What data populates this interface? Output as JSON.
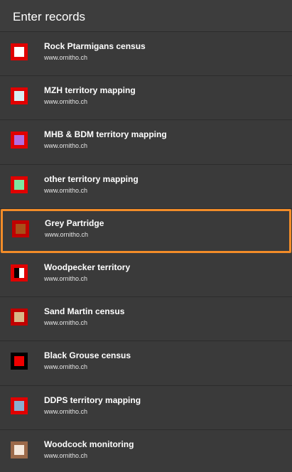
{
  "header": {
    "title": "Enter records"
  },
  "selected_index": 4,
  "items": [
    {
      "title": "Rock Ptarmigans census",
      "subtitle": "www.ornitho.ch",
      "icon": "square-white-on-red",
      "outer": "#e00000",
      "inner": "#ffffff"
    },
    {
      "title": "MZH territory mapping",
      "subtitle": "www.ornitho.ch",
      "icon": "square-lightcyan-on-red",
      "outer": "#e00000",
      "inner": "#d8eef2"
    },
    {
      "title": "MHB & BDM territory mapping",
      "subtitle": "www.ornitho.ch",
      "icon": "square-violet-on-red",
      "outer": "#e00000",
      "inner": "#b46de0"
    },
    {
      "title": "other territory mapping",
      "subtitle": "www.ornitho.ch",
      "icon": "square-green-on-red",
      "outer": "#e00000",
      "inner": "#7ee6a0"
    },
    {
      "title": "Grey Partridge",
      "subtitle": "www.ornitho.ch",
      "icon": "square-brown-on-red",
      "outer": "#c00000",
      "inner": "#a8501a"
    },
    {
      "title": "Woodpecker territory",
      "subtitle": "www.ornitho.ch",
      "icon": "square-blackwhite-on-red",
      "outer": "#e00000",
      "inner": "split"
    },
    {
      "title": "Sand Martin census",
      "subtitle": "www.ornitho.ch",
      "icon": "square-tan-on-red",
      "outer": "#c00000",
      "inner": "#d8b888"
    },
    {
      "title": "Black Grouse census",
      "subtitle": "www.ornitho.ch",
      "icon": "square-red-on-black",
      "outer": "#000000",
      "inner": "#ee0000"
    },
    {
      "title": "DDPS territory mapping",
      "subtitle": "www.ornitho.ch",
      "icon": "square-steelblue-on-red",
      "outer": "#e00000",
      "inner": "#8aaed0"
    },
    {
      "title": "Woodcock monitoring",
      "subtitle": "www.ornitho.ch",
      "icon": "square-cream-on-brown",
      "outer": "#9c6a4a",
      "inner": "#f5e8dc"
    }
  ]
}
